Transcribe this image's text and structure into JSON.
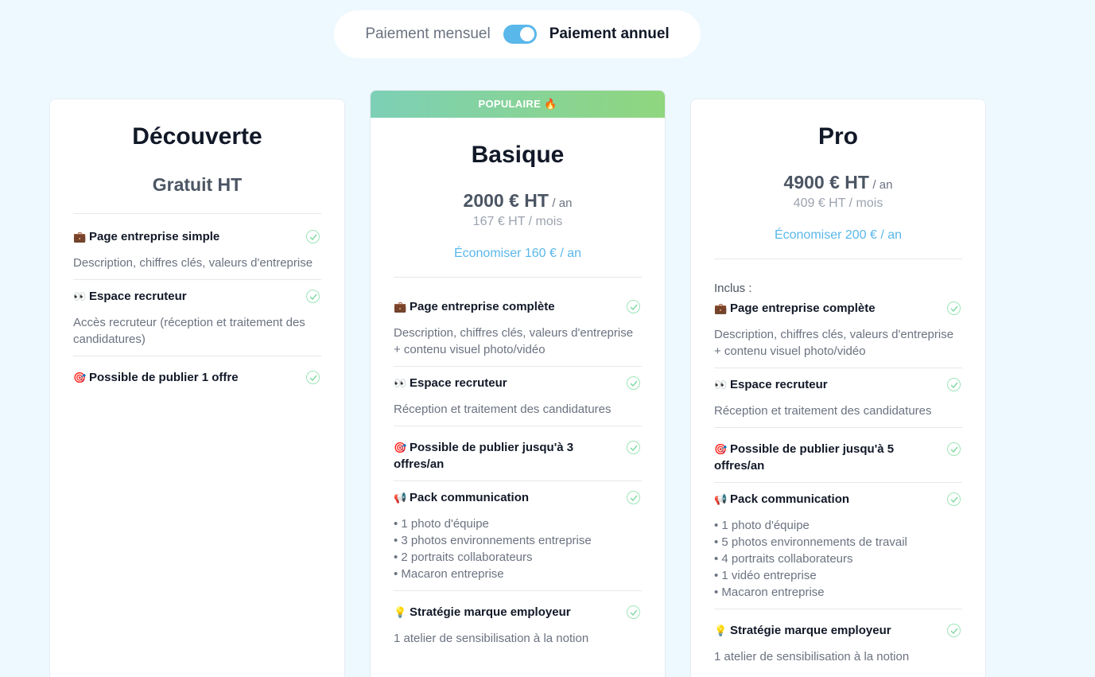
{
  "billing": {
    "monthly_label": "Paiement mensuel",
    "annual_label": "Paiement annuel",
    "annual_selected": true
  },
  "plans": [
    {
      "name": "Découverte",
      "price": "Gratuit HT",
      "features": [
        {
          "emoji": "💼",
          "title": "Page entreprise simple",
          "desc": "Description, chiffres clés, valeurs d'entreprise"
        },
        {
          "emoji": "👀",
          "title": "Espace recruteur",
          "desc": "Accès recruteur (réception et traitement des candidatures)"
        },
        {
          "emoji": "🎯",
          "title": "Possible de publier 1 offre"
        }
      ]
    },
    {
      "badge": "POPULAIRE 🔥",
      "name": "Basique",
      "price": "2000 € HT",
      "price_unit": "/ an",
      "price_monthly": "167 € HT / mois",
      "savings": "Économiser 160 € / an",
      "features": [
        {
          "emoji": "💼",
          "title": "Page entreprise complète",
          "desc": "Description, chiffres clés, valeurs d'entreprise + contenu visuel photo/vidéo"
        },
        {
          "emoji": "👀",
          "title": "Espace recruteur",
          "desc": "Réception et traitement des candidatures"
        },
        {
          "emoji": "🎯",
          "title": "Possible de publier jusqu'à 3 offres/an"
        },
        {
          "emoji": "📢",
          "title": "Pack communication",
          "bullets": [
            "• 1 photo d'équipe",
            "• 3 photos environnements entreprise",
            "• 2 portraits collaborateurs",
            "• Macaron entreprise"
          ]
        },
        {
          "emoji": "💡",
          "title": "Stratégie marque employeur",
          "desc": "1 atelier de sensibilisation à la notion"
        }
      ]
    },
    {
      "name": "Pro",
      "price": "4900 € HT",
      "price_unit": "/ an",
      "price_monthly": "409 € HT / mois",
      "savings": "Économiser 200 € / an",
      "included_label": "Inclus :",
      "features": [
        {
          "emoji": "💼",
          "title": "Page entreprise complète",
          "desc": "Description, chiffres clés, valeurs d'entreprise + contenu visuel photo/vidéo"
        },
        {
          "emoji": "👀",
          "title": "Espace recruteur",
          "desc": "Réception et traitement des candidatures"
        },
        {
          "emoji": "🎯",
          "title": "Possible de publier jusqu'à 5 offres/an"
        },
        {
          "emoji": "📢",
          "title": "Pack communication",
          "bullets": [
            "• 1 photo d'équipe",
            "• 5 photos environnements de travail",
            "• 4 portraits collaborateurs",
            "• 1 vidéo entreprise",
            "• Macaron entreprise"
          ]
        },
        {
          "emoji": "💡",
          "title": "Stratégie marque employeur",
          "desc": "1 atelier de sensibilisation à la notion"
        }
      ]
    }
  ],
  "colors": {
    "background": "#eef8ff",
    "accent": "#5ab7ea",
    "check": "#9ee5b8",
    "badge_gradient_start": "#7dd0b6",
    "badge_gradient_end": "#8fd67e"
  }
}
